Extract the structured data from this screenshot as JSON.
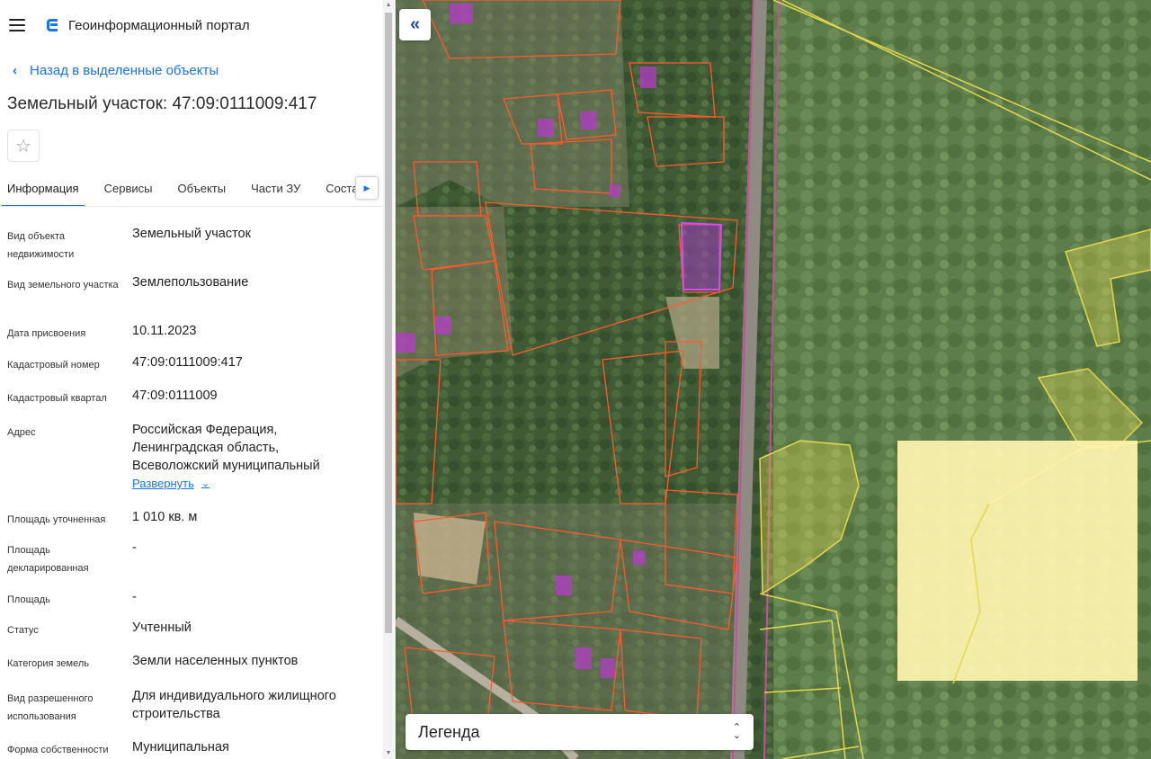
{
  "header": {
    "title": "Геоинформационный портал",
    "menu_icon": "hamburger-icon",
    "logo_icon": "portal-logo-icon",
    "accent": "#1a73e8"
  },
  "back_link": {
    "label": "Назад в выделенные объекты",
    "icon": "chevron-left-icon"
  },
  "object": {
    "title": "Земельный участок: 47:09:0111009:417",
    "favorite_icon": "star-icon"
  },
  "tabs": [
    {
      "label": "Информация",
      "active": true
    },
    {
      "label": "Сервисы"
    },
    {
      "label": "Объекты"
    },
    {
      "label": "Части ЗУ"
    },
    {
      "label": "Соста"
    }
  ],
  "info": [
    {
      "label": "Вид объекта недвижимости",
      "value": "Земельный участок"
    },
    {
      "label": "Вид земельного участка",
      "value": "Землепользование"
    },
    {
      "label": "Дата присвоения",
      "value": "10.11.2023"
    },
    {
      "label": "Кадастровый номер",
      "value": "47:09:0111009:417"
    },
    {
      "label": "Кадастровый квартал",
      "value": "47:09:0111009"
    },
    {
      "label": "Адрес",
      "value": "Российская Федерация, Ленинградская область, Всеволожский муниципальный",
      "expand": "Развернуть"
    },
    {
      "label": "Площадь уточненная",
      "value": "1 010 кв. м"
    },
    {
      "label": "Площадь декларированная",
      "value": "-"
    },
    {
      "label": "Площадь",
      "value": "-"
    },
    {
      "label": "Статус",
      "value": "Учтенный"
    },
    {
      "label": "Категория земель",
      "value": "Земли населенных пунктов"
    },
    {
      "label": "Вид разрешенного использования",
      "value": "Для индивидуального жилищного строительства"
    },
    {
      "label": "Форма собственности",
      "value": "Муниципальная"
    }
  ],
  "map": {
    "collapse_icon": "double-chevron-left-icon",
    "legend_label": "Легенда",
    "parcel_stroke": "#ff5a2c",
    "highlight_fill": "#b53cc8",
    "zone_fill": "#fff5b0"
  }
}
